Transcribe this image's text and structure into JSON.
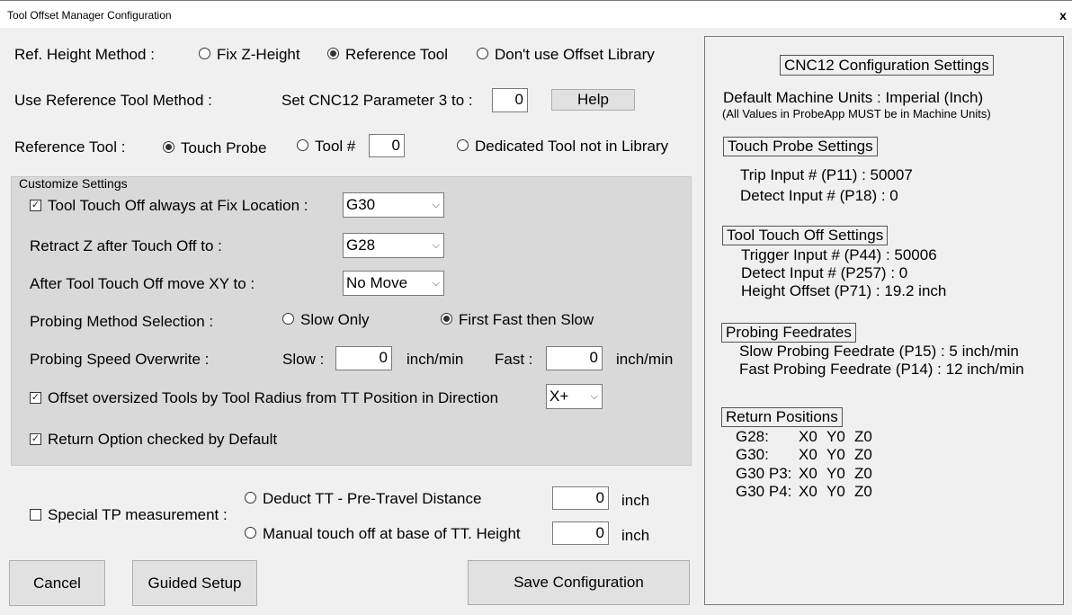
{
  "window": {
    "title": "Tool Offset Manager Configuration",
    "close_glyph": "x"
  },
  "ref_height": {
    "label": "Ref. Height Method :",
    "options": [
      "Fix Z-Height",
      "Reference Tool",
      "Don't use Offset Library"
    ],
    "selected": "Reference Tool"
  },
  "ref_tool_method": {
    "label": "Use Reference Tool Method :",
    "param_label": "Set CNC12 Parameter 3 to :",
    "param_value": "0",
    "help_label": "Help"
  },
  "reference_tool": {
    "label": "Reference Tool :",
    "touch_probe": "Touch Probe",
    "tool_num": "Tool #",
    "tool_num_value": "0",
    "dedicated": "Dedicated Tool not in Library",
    "selected": "Touch Probe"
  },
  "customize": {
    "title": "Customize Settings",
    "fix_location_label": "Tool Touch Off always at Fix Location :",
    "fix_location_checked": true,
    "fix_location_value": "G30",
    "retract_label": "Retract Z after Touch Off to :",
    "retract_value": "G28",
    "after_move_label": "After Tool Touch Off move XY to :",
    "after_move_value": "No Move",
    "probing_method_label": "Probing Method Selection :",
    "slow_only": "Slow Only",
    "fast_then_slow": "First Fast then Slow",
    "probing_method_selected": "First Fast then Slow",
    "speed_label": "Probing Speed Overwrite :",
    "slow_label": "Slow :",
    "slow_value": "0",
    "slow_unit": "inch/min",
    "fast_label": "Fast :",
    "fast_value": "0",
    "fast_unit": "inch/min",
    "oversized_label": "Offset oversized Tools by Tool Radius from TT Position in Direction",
    "oversized_checked": true,
    "oversized_value": "X+",
    "return_label": "Return Option checked by Default",
    "return_checked": true
  },
  "special_tp": {
    "label": "Special TP measurement :",
    "checked": false,
    "deduct_label": "Deduct TT - Pre-Travel Distance",
    "deduct_value": "0",
    "deduct_unit": "inch",
    "manual_label": "Manual touch off at base of TT. Height",
    "manual_value": "0",
    "manual_unit": "inch"
  },
  "buttons": {
    "cancel": "Cancel",
    "guided": "Guided Setup",
    "save": "Save Configuration"
  },
  "cnc12": {
    "title": "CNC12 Configuration Settings",
    "units": "Default Machine Units : Imperial (Inch)",
    "units_note": "(All Values in ProbeApp MUST be in Machine Units)",
    "touch_probe_head": "Touch Probe Settings",
    "trip_input": "Trip Input # (P11) : 50007",
    "detect_input_tp": "Detect Input # (P18) : 0",
    "tt_head": "Tool Touch Off Settings",
    "trigger_input": "Trigger Input # (P44) : 50006",
    "detect_input_tt": "Detect Input # (P257) : 0",
    "height_offset": "Height Offset (P71) : 19.2 inch",
    "feed_head": "Probing Feedrates",
    "slow_feed": "Slow Probing Feedrate (P15) : 5 inch/min",
    "fast_feed": "Fast Probing Feedrate (P14) : 12 inch/min",
    "return_head": "Return Positions",
    "positions": [
      {
        "name": "G28:",
        "x": "X0",
        "y": "Y0",
        "z": "Z0"
      },
      {
        "name": "G30:",
        "x": "X0",
        "y": "Y0",
        "z": "Z0"
      },
      {
        "name": "G30 P3:",
        "x": "X0",
        "y": "Y0",
        "z": "Z0"
      },
      {
        "name": "G30 P4:",
        "x": "X0",
        "y": "Y0",
        "z": "Z0"
      }
    ]
  },
  "icons": {
    "chevron": "chevron-down-icon",
    "check": "check-icon",
    "close": "close-icon"
  }
}
